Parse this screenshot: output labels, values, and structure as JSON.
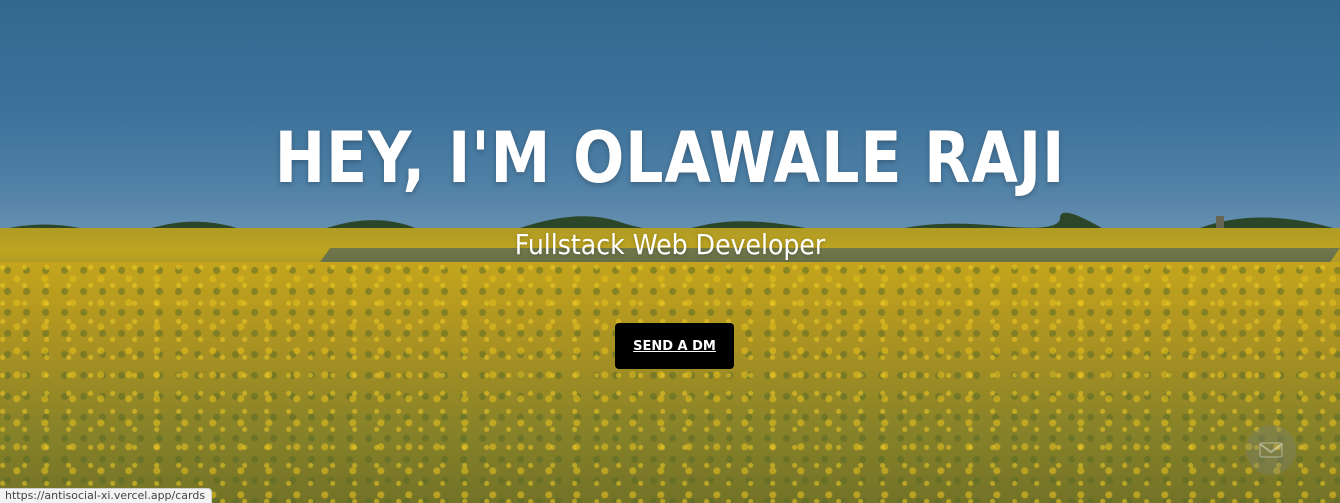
{
  "hero": {
    "title": "HEY, I'M OLAWALE RAJI",
    "subtitle": "Fullstack Web Developer",
    "cta_label": "SEND A DM",
    "background": "sunflower-field-image"
  },
  "status_bar": {
    "url": "https://antisocial-xi.vercel.app/cards"
  },
  "colors": {
    "title": "#ffffff",
    "button_bg": "#000000",
    "button_text": "#ffffff"
  }
}
